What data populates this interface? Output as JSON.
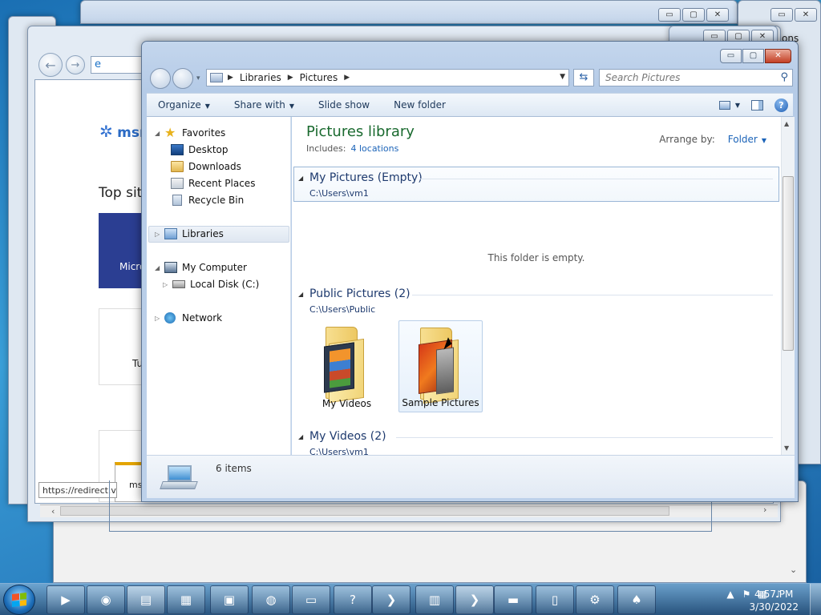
{
  "window": {
    "caption_min": "▭",
    "caption_max": "▢",
    "caption_close": "✕"
  },
  "browser": {
    "msn_logo": "msn",
    "top_sites": "Top sit",
    "tile_blue_text": "Micro",
    "tile_white_text": "Tu",
    "tile_msn_text": "ms",
    "status_url": "https://redirect.v",
    "bg_tab_text": "tions"
  },
  "explorer": {
    "breadcrumb": [
      "Libraries",
      "Pictures"
    ],
    "search_placeholder": "Search Pictures",
    "toolbar": {
      "organize": "Organize",
      "share_with": "Share with",
      "slide_show": "Slide show",
      "new_folder": "New folder"
    },
    "nav": {
      "favorites": "Favorites",
      "desktop": "Desktop",
      "downloads": "Downloads",
      "recent_places": "Recent Places",
      "recycle_bin": "Recycle Bin",
      "libraries": "Libraries",
      "my_computer": "My Computer",
      "local_disk": "Local Disk (C:)",
      "network": "Network"
    },
    "library_title": "Pictures library",
    "includes_label": "Includes:",
    "includes_link": "4 locations",
    "arrange_label": "Arrange by:",
    "arrange_value": "Folder",
    "groups": [
      {
        "title": "My Pictures (Empty)",
        "path": "C:\\Users\\vm1",
        "empty_msg": "This folder is empty."
      },
      {
        "title": "Public Pictures (2)",
        "path": "C:\\Users\\Public",
        "items": [
          "My Videos",
          "Sample Pictures"
        ]
      },
      {
        "title": "My Videos (2)",
        "path": "C:\\Users\\vm1"
      }
    ],
    "details_count": "6 items"
  },
  "taskbar": {
    "time": "4:57 PM",
    "date": "3/30/2022"
  }
}
